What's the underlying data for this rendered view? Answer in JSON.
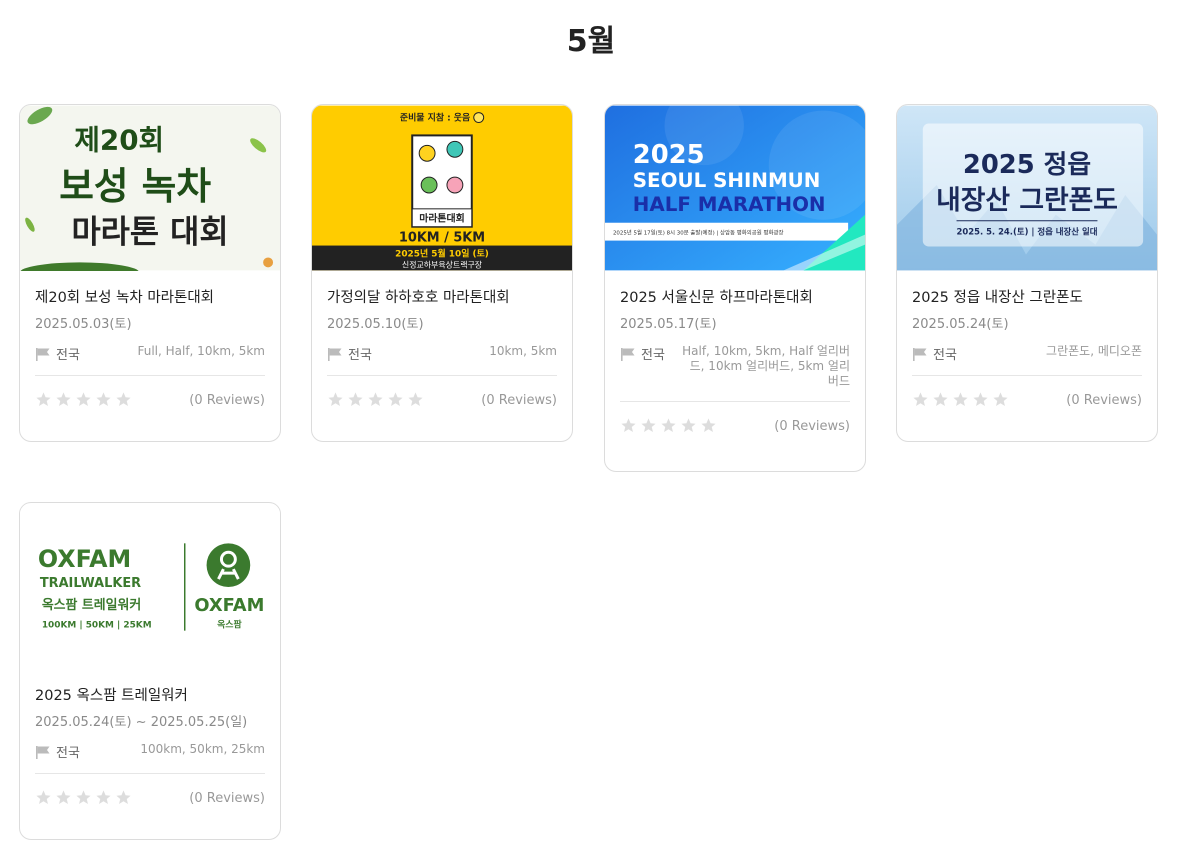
{
  "month": "5월",
  "events": [
    {
      "banner": {
        "line1": "제20회",
        "line2": "보성 녹차",
        "line3": "마라톤 대회"
      },
      "title": "제20회 보성 녹차 마라톤대회",
      "date": "2025.05.03(토)",
      "region": "전국",
      "courses": "Full, Half, 10km, 5km",
      "rating": 0,
      "reviews": "(0 Reviews)"
    },
    {
      "banner": {
        "top": "준비물 지참 : 웃음",
        "name": "마라톤대회",
        "km": "10KM / 5KM",
        "date": "2025년 5월 10일 (토)",
        "place": "신정교하부육상트랙구장"
      },
      "title": "가정의달 하하호호 마라톤대회",
      "date": "2025.05.10(토)",
      "region": "전국",
      "courses": "10km, 5km",
      "rating": 0,
      "reviews": "(0 Reviews)"
    },
    {
      "banner": {
        "line1": "2025",
        "line2": "SEOUL SHINMUN",
        "line3": "HALF MARATHON",
        "info": "2025년 5월 17일(토) 8시 30분 출발(예정)  |  상암동 평화의공원 평화광장"
      },
      "title": "2025 서울신문 하프마라톤대회",
      "date": "2025.05.17(토)",
      "region": "전국",
      "courses": "Half, 10km, 5km, Half 얼리버드, 10km 얼리버드, 5km 얼리버드",
      "rating": 0,
      "reviews": "(0 Reviews)"
    },
    {
      "banner": {
        "line1": "2025 정읍",
        "line2": "내장산 그란폰도",
        "info": "2025. 5. 24.(토) | 정읍 내장산 일대"
      },
      "title": "2025 정읍 내장산 그란폰도",
      "date": "2025.05.24(토)",
      "region": "전국",
      "courses": "그란폰도, 메디오폰",
      "rating": 0,
      "reviews": "(0 Reviews)"
    },
    {
      "banner": {
        "line1": "OXFAM",
        "line2": "TRAILWALKER",
        "line3": "옥스팜 트레일워커",
        "line4": "100KM | 50KM | 25KM",
        "brand": "OXFAM",
        "brand_kr": "옥스팜"
      },
      "title": "2025 옥스팜 트레일워커",
      "date": "2025.05.24(토) ~ 2025.05.25(일)",
      "region": "전국",
      "courses": "100km, 50km, 25km",
      "rating": 0,
      "reviews": "(0 Reviews)"
    }
  ],
  "colors": {
    "star_empty": "#dddddd",
    "flag": "#bbbbbb",
    "green": "#3b7a2e",
    "yellow": "#ffcc00",
    "blue": "#2a7fe8",
    "oxfam": "#4a8a2a"
  }
}
